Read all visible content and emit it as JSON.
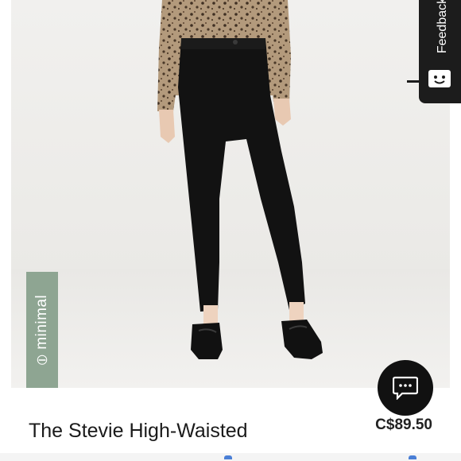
{
  "product": {
    "tag_label": "minimal",
    "title": "The Stevie High-Waisted",
    "price": "C$89.50"
  },
  "feedback": {
    "label": "Feedback"
  },
  "icons": {
    "chat": "chat-bubble-icon",
    "feedback": "smiley-box-icon",
    "tag": "minimal-circle-line-icon"
  },
  "colors": {
    "tag_background": "#8ea592",
    "feedback_background": "#1c1c1c",
    "chat_background": "#111111"
  }
}
